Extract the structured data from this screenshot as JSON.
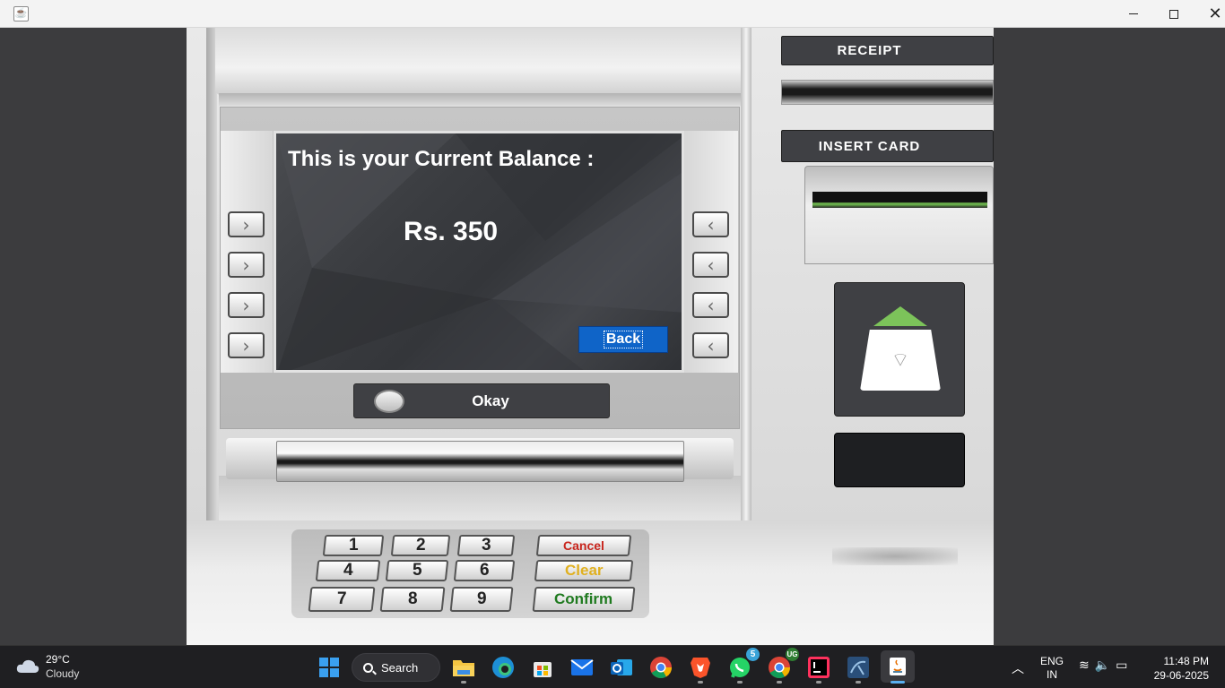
{
  "window": {
    "icon": "java-cup-icon",
    "controls": {
      "minimize": "minimize-icon",
      "maximize": "maximize-icon",
      "close": "close-icon"
    }
  },
  "atm": {
    "screen": {
      "title": "This is your Current Balance :",
      "balance": "Rs. 350",
      "back_label": "Back"
    },
    "okay_label": "Okay",
    "receipt_label": "RECEIPT",
    "insert_card_label": "INSERT CARD",
    "keypad": {
      "keys": [
        "1",
        "2",
        "3",
        "4",
        "5",
        "6",
        "7",
        "8",
        "9"
      ],
      "cancel": "Cancel",
      "clear": "Clear",
      "confirm": "Confirm"
    },
    "colors": {
      "back_button": "#0f64c8",
      "nfc_arrow": "#7cc35a",
      "cancel": "#c8241c",
      "clear": "#e0b020",
      "confirm": "#1f7a1f"
    }
  },
  "taskbar": {
    "weather": {
      "temp": "29°C",
      "desc": "Cloudy",
      "icon": "cloud-icon"
    },
    "search_label": "Search",
    "apps": [
      {
        "name": "start",
        "icon": "windows-icon"
      },
      {
        "name": "file-explorer",
        "icon": "folder-icon"
      },
      {
        "name": "edge",
        "icon": "edge-icon"
      },
      {
        "name": "store",
        "icon": "store-icon"
      },
      {
        "name": "mail",
        "icon": "mail-icon"
      },
      {
        "name": "outlook",
        "icon": "outlook-icon"
      },
      {
        "name": "chrome",
        "icon": "chrome-icon"
      },
      {
        "name": "brave",
        "icon": "brave-icon"
      },
      {
        "name": "whatsapp",
        "icon": "whatsapp-icon",
        "badge": "5"
      },
      {
        "name": "chrome-profile",
        "icon": "chrome-icon",
        "badge": "UG"
      },
      {
        "name": "intellij",
        "icon": "intellij-icon"
      },
      {
        "name": "mysql",
        "icon": "mysql-icon"
      },
      {
        "name": "java",
        "icon": "java-icon"
      }
    ],
    "lang_line1": "ENG",
    "lang_line2": "IN",
    "time": "11:48 PM",
    "date": "29-06-2025"
  }
}
